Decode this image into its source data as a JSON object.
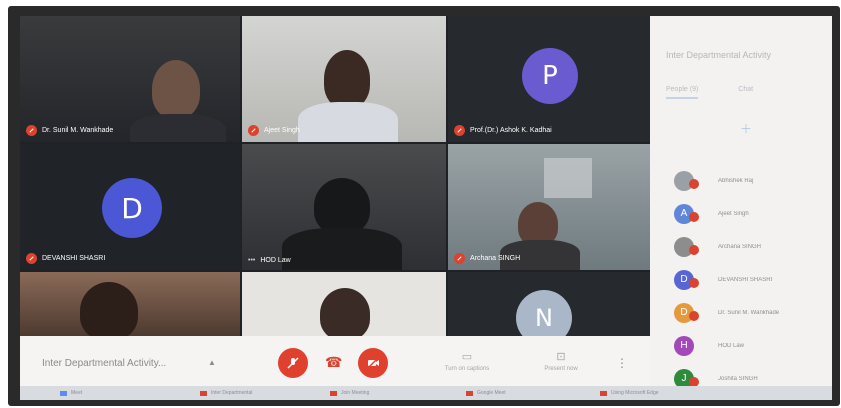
{
  "meeting": {
    "title": "Inter Departmental Activity...",
    "panel_title": "Inter Departmental Activity",
    "tabs": [
      "People (9)",
      "Chat"
    ]
  },
  "tiles": [
    {
      "name": "Dr. Sunil M. Wankhade",
      "muted": true,
      "kind": "video"
    },
    {
      "name": "Ajeet Singh",
      "muted": true,
      "kind": "video"
    },
    {
      "name": "Prof.(Dr.) Ashok K. Kadhai",
      "muted": true,
      "kind": "avatar",
      "initial": "P",
      "color": "#6b5bd1"
    },
    {
      "name": "DEVANSHI SHASRI",
      "muted": true,
      "kind": "avatar",
      "initial": "D",
      "color": "#4c57d6"
    },
    {
      "name": "HOD Law",
      "muted": false,
      "kind": "video"
    },
    {
      "name": "Archana SINGH",
      "muted": true,
      "kind": "video"
    },
    {
      "name": "",
      "muted": false,
      "kind": "video"
    },
    {
      "name": "",
      "muted": false,
      "kind": "video"
    },
    {
      "name": "",
      "muted": false,
      "kind": "avatar",
      "initial": "N",
      "color": "#a9b7c8"
    }
  ],
  "participants": [
    {
      "name": "Abhishek Raj",
      "initial": "",
      "color": "#9aa0a6",
      "muted": true
    },
    {
      "name": "Ajeet Singh",
      "initial": "A",
      "color": "#5f86d8",
      "muted": true
    },
    {
      "name": "Archana SINGH",
      "initial": "",
      "color": "#8d8d8d",
      "muted": true
    },
    {
      "name": "DEVANSHI SHASRI",
      "initial": "D",
      "color": "#5866d4",
      "muted": true
    },
    {
      "name": "Dr. Sunil M. Wankhade",
      "initial": "D",
      "color": "#e49a3c",
      "muted": true
    },
    {
      "name": "HOD Law",
      "initial": "H",
      "color": "#a248b8",
      "muted": false
    },
    {
      "name": "Joshita SINGH",
      "initial": "J",
      "color": "#2f8a3e",
      "muted": true
    }
  ],
  "controls": {
    "mic_icon": "mic-off-icon",
    "hangup_icon": "phone-hangup-icon",
    "camera_icon": "camera-off-icon",
    "captions_label": "Turn on captions",
    "present_label": "Present now",
    "more_label": "⋮"
  },
  "taskbar": {
    "items": [
      "Meet",
      "Inter Departmental",
      "Join Meeting",
      "Google Meet",
      "Using Microsoft Edge"
    ]
  },
  "colors": {
    "accent_red": "#d9432f",
    "grid_bg": "#1e2126",
    "panel_bg": "#f3f2f1"
  }
}
